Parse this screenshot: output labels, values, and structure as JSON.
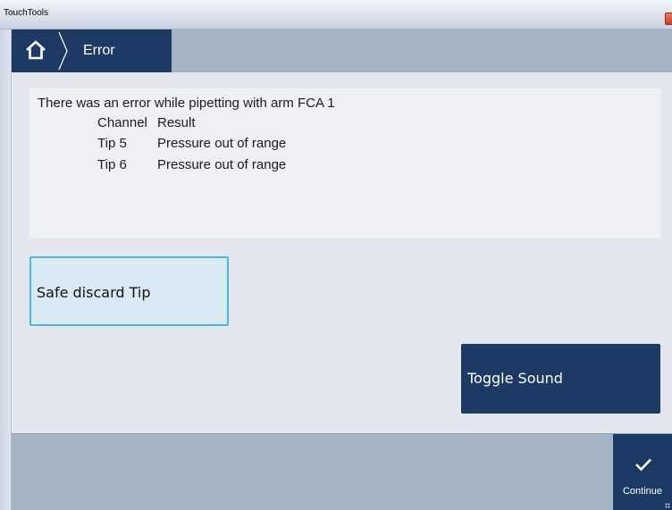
{
  "window": {
    "title": "TouchTools"
  },
  "header": {
    "home_icon": "home-icon",
    "title": "Error"
  },
  "message": {
    "line1": "There was an error while pipetting with arm FCA 1",
    "columns": [
      "Channel",
      "Result"
    ],
    "rows": [
      {
        "channel": "Tip 5",
        "result": "Pressure out of range"
      },
      {
        "channel": "Tip 6",
        "result": "Pressure out of range"
      }
    ]
  },
  "buttons": {
    "safe_discard": "Safe discard Tip",
    "toggle_sound": "Toggle Sound",
    "continue": "Continue",
    "continue_icon": "checkmark-icon"
  },
  "colors": {
    "accent_dark": "#1c3a63",
    "header_bg": "#a3b4c6",
    "selected_border": "#4cb7e2",
    "selected_bg": "#daeaf4"
  }
}
